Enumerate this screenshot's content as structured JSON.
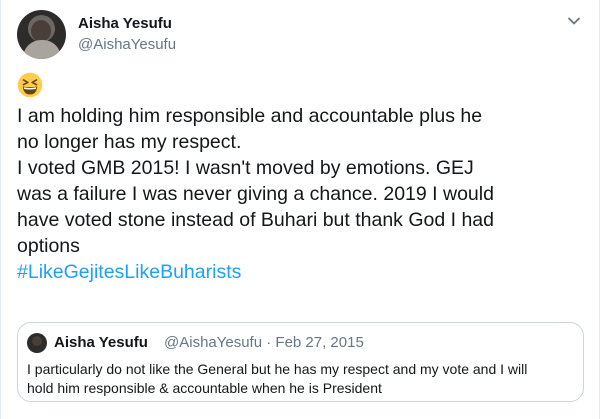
{
  "author": {
    "name": "Aisha Yesufu",
    "handle": "@AishaYesufu"
  },
  "icons": {
    "more": "chevron-down-icon",
    "emoji": "grinning-squinting-face-icon",
    "avatar": "profile-photo"
  },
  "tweet": {
    "lines": [
      "I am holding him responsible and accountable plus he",
      "no longer has my respect.",
      "I voted GMB 2015! I wasn't moved by emotions. GEJ",
      "was a failure I was never giving a chance. 2019 I would",
      "have voted stone instead of Buhari but thank God I had",
      "options"
    ],
    "hashtag": "#LikeGejitesLikeBuharists"
  },
  "quoted": {
    "name": "Aisha Yesufu",
    "handle_date": "@AishaYesufu · Feb 27, 2015",
    "lines": [
      "I particularly do not like the General but he has my respect and my vote and I will",
      "hold him responsible & accountable when he is President"
    ]
  },
  "colors": {
    "text": "#14171a",
    "secondary": "#657786",
    "link": "#1da1f2",
    "border": "#ccd6dd"
  }
}
